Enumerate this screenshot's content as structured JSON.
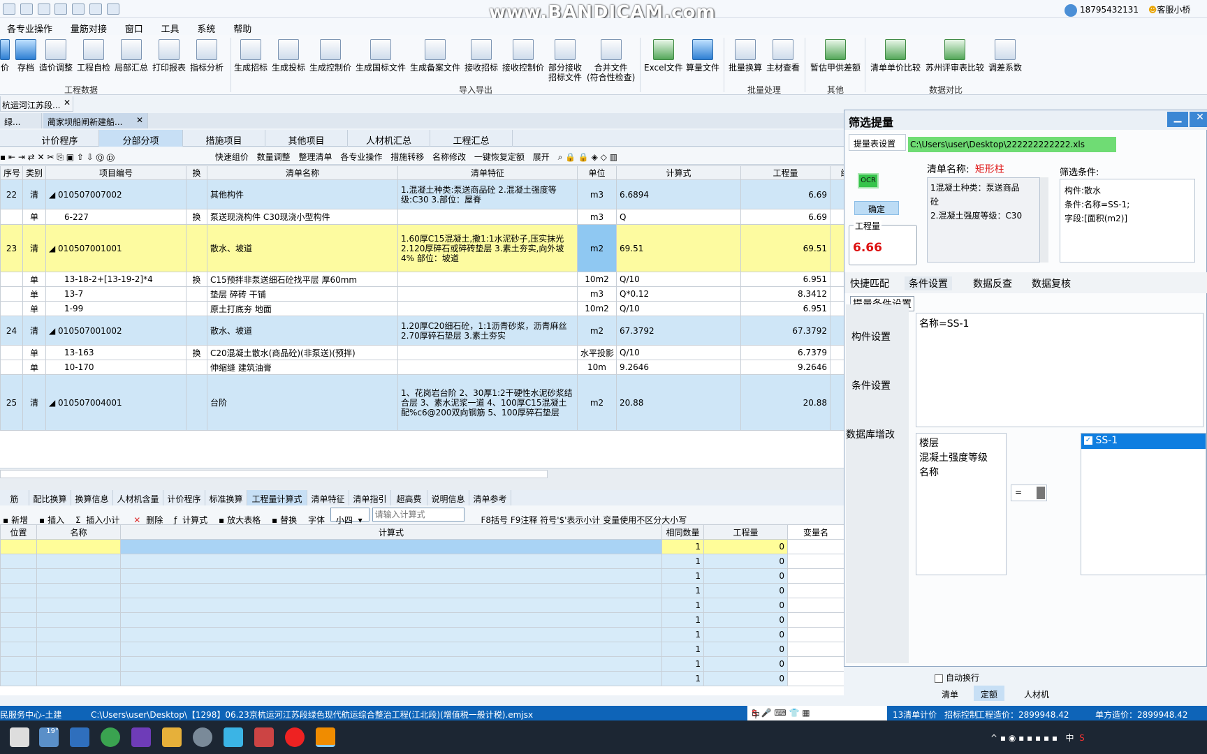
{
  "app": {
    "watermark": "www.BANDICAM.com",
    "user_phone": "18795432131",
    "support_label": "客服小桥"
  },
  "menu": [
    "各专业操作",
    "量筋对接",
    "窗口",
    "工具",
    "系统",
    "帮助"
  ],
  "ribbon": {
    "group1_buttons": [
      "价",
      "存档",
      "造价调整",
      "工程自检",
      "局部汇总",
      "打印报表",
      "指标分析"
    ],
    "group1_label": "工程数据",
    "group2_buttons": [
      "生成招标",
      "生成投标",
      "生成控制价",
      "生成国标文件",
      "生成备案文件",
      "接收招标",
      "接收控制价",
      "部分接收\n招标文件",
      "合并文件\n(符合性检查)",
      "Excel文件",
      "算量文件"
    ],
    "group2_label": "导入导出",
    "group3_buttons": [
      "批量换算",
      "主材查看"
    ],
    "group3_label": "批量处理",
    "group4_buttons": [
      "暂估甲供差额"
    ],
    "group4_label": "其他",
    "group5_buttons": [
      "清单单价比较",
      "苏州评审表比较",
      "调差系数"
    ],
    "group5_label": "数据对比"
  },
  "doc_tab_1": "杭运河江苏段...",
  "doc_tab_2a": "绿...",
  "doc_tab_2b": "蔺家坝船闸新建船...",
  "sub_tabs": [
    "计价程序",
    "分部分项",
    "措施项目",
    "其他项目",
    "人材机汇总",
    "工程汇总"
  ],
  "toolbar": [
    "快速组价",
    "数量调整",
    "整理清单",
    "各专业操作",
    "措施转移",
    "名称修改",
    "一键恢复定额",
    "展开"
  ],
  "grid": {
    "headers": [
      "序号",
      "类别",
      "项目编号",
      "换",
      "清单名称",
      "清单特征",
      "单位",
      "计算式",
      "工程量",
      "综"
    ],
    "rows": [
      {
        "no": "22",
        "type": "清",
        "code": "◢ 010507007002",
        "chg": "",
        "name": "其他构件",
        "feat": "1.混凝土种类:泵送商品砼\n2.混凝土强度等级:C30\n3.部位：屋脊",
        "unit": "m3",
        "expr": "6.6894",
        "qty": "6.69"
      },
      {
        "no": "",
        "type": "单",
        "code": "6-227",
        "chg": "换",
        "name": "泵送现浇构件  C30现浇小型构件",
        "feat": "",
        "unit": "m3",
        "expr": "Q",
        "qty": "6.69"
      },
      {
        "no": "23",
        "type": "清",
        "code": "◢ 010507001001",
        "chg": "",
        "name": "散水、坡道",
        "feat": "1.60厚C15混凝土,撒1:1水泥砂子,压实抹光\n2.120厚碎石或碎砖垫层\n3.素土夯实,向外坡4%\n部位：坡道",
        "unit": "m2",
        "expr": "69.51",
        "qty": "69.51"
      },
      {
        "no": "",
        "type": "单",
        "code": "13-18-2+[13-19-2]*4",
        "chg": "换",
        "name": "C15预拌非泵送细石砼找平层 厚60mm",
        "feat": "",
        "unit": "10m2",
        "expr": "Q/10",
        "qty": "6.951"
      },
      {
        "no": "",
        "type": "单",
        "code": "13-7",
        "chg": "",
        "name": "垫层  碎砖  干铺",
        "feat": "",
        "unit": "m3",
        "expr": "Q*0.12",
        "qty": "8.3412"
      },
      {
        "no": "",
        "type": "单",
        "code": "1-99",
        "chg": "",
        "name": "原土打底夯  地面",
        "feat": "",
        "unit": "10m2",
        "expr": "Q/10",
        "qty": "6.951"
      },
      {
        "no": "24",
        "type": "清",
        "code": "◢ 010507001002",
        "chg": "",
        "name": "散水、坡道",
        "feat": "1.20厚C20细石砼，1:1沥青砂浆，沥青麻丝\n2.70厚碎石垫层\n3.素土夯实",
        "unit": "m2",
        "expr": "67.3792",
        "qty": "67.3792"
      },
      {
        "no": "",
        "type": "单",
        "code": "13-163",
        "chg": "换",
        "name": "C20混凝土散水(商品砼)(非泵送)(预拌)",
        "feat": "",
        "unit": "水平投影",
        "expr": "Q/10",
        "qty": "6.7379"
      },
      {
        "no": "",
        "type": "单",
        "code": "10-170",
        "chg": "",
        "name": "伸缩缝  建筑油膏",
        "feat": "",
        "unit": "10m",
        "expr": "9.2646",
        "qty": "9.2646"
      },
      {
        "no": "25",
        "type": "清",
        "code": "◢ 010507004001",
        "chg": "",
        "name": "台阶",
        "feat": "1、花岗岩台阶\n2、30厚1:2干硬性水泥砂浆结合层\n3、素水泥浆一道\n4、100厚C15混凝土配%c6@200双向钢筋\n5、100厚碎石垫层",
        "unit": "m2",
        "expr": "20.88",
        "qty": "20.88"
      }
    ]
  },
  "bottom_tabs": [
    "筋",
    "配比换算",
    "换算信息",
    "人材机含量",
    "计价程序",
    "标准换算",
    "工程量计算式",
    "清单特征",
    "清单指引",
    "超高费",
    "说明信息",
    "清单参考"
  ],
  "bottom_toolbar": {
    "add": "新增",
    "insert": "插入",
    "insert_subtotal": "插入小计",
    "delete": "删除",
    "calc": "计算式",
    "enlarge": "放大表格",
    "replace": "替换",
    "font": "字体",
    "font_size": "小四",
    "formula_placeholder": "请输入计算式",
    "hint": "F8括号 F9注释 符号'$'表示小计 变量使用不区分大小写"
  },
  "bottom_grid": {
    "headers": [
      "位置",
      "名称",
      "计算式",
      "相同数量",
      "工程量",
      "变量名"
    ],
    "rows": [
      [
        "",
        "",
        "",
        "1",
        "0"
      ],
      [
        "",
        "",
        "",
        "1",
        "0"
      ],
      [
        "",
        "",
        "",
        "1",
        "0"
      ],
      [
        "",
        "",
        "",
        "1",
        "0"
      ],
      [
        "",
        "",
        "",
        "1",
        "0"
      ],
      [
        "",
        "",
        "",
        "1",
        "0"
      ],
      [
        "",
        "",
        "",
        "1",
        "0"
      ],
      [
        "",
        "",
        "",
        "1",
        "0"
      ],
      [
        "",
        "",
        "",
        "1",
        "0"
      ],
      [
        "",
        "",
        "",
        "1",
        "0"
      ]
    ]
  },
  "dialog": {
    "title": "筛选提量",
    "path_label": "提量表设置",
    "path_value": "C:\\Users\\user\\Desktop\\222222222222.xls",
    "ocr": "OCR",
    "confirm": "确定",
    "qty_label": "工程量",
    "qty_value": "6.66",
    "list_name_label": "清单名称:",
    "list_name_value": "矩形柱",
    "feature_text": "1混凝土种类：泵送商品砼\n2.混凝土强度等级：C30",
    "filter_label": "筛选条件:",
    "filter_text": "构件:散水\n条件:名称=SS-1;\n字段:[面积(m2)]",
    "tabs": [
      "快捷匹配",
      "条件设置",
      "数据反查",
      "数据复核"
    ],
    "section": "提量条件设置",
    "nav": [
      "构件设置",
      "条件设置",
      "数据库增改"
    ],
    "condition_text": "名称=SS-1",
    "fields": [
      "楼层",
      "混凝土强度等级",
      "名称"
    ],
    "operator": "=",
    "values": [
      "SS-1"
    ],
    "auto_wrap": "自动换行",
    "bottom_tabs": [
      "清单",
      "定额",
      "人材机"
    ]
  },
  "status": {
    "left": "民服务中心-土建",
    "path": "C:\\Users\\user\\Desktop\\【1298】06.23京杭运河江苏段绿色现代航运综合整治工程(江北段)(增值税一般计税).emjsx",
    "ime": "中",
    "right1": "13清单计价",
    "right2": "招标控制",
    "right3": "工程造价：2899948.42",
    "right4": "单方造价：2899948.42"
  },
  "taskbar": {
    "weather": "19°",
    "ime": "中"
  }
}
